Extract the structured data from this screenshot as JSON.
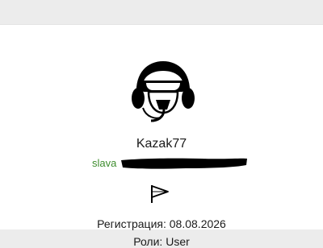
{
  "profile": {
    "username": "Kazak77",
    "email_visible": "slava",
    "avatar_icon": "pilot-helmet-icon",
    "report_icon": "flag-icon",
    "registration_label": "Регистрация:",
    "registration_date": "08.08.2026",
    "roles_label": "Роли:",
    "roles_value": "User"
  },
  "colors": {
    "email_green": "#3e8d2e",
    "redaction_black": "#000000",
    "card_background": "#ffffff"
  }
}
